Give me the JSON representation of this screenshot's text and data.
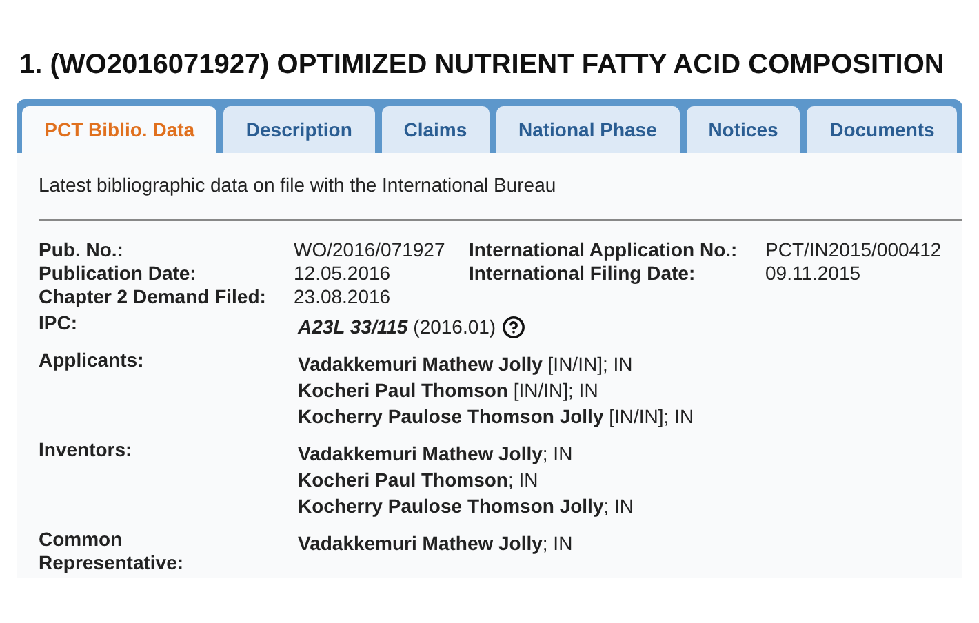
{
  "title": "1. (WO2016071927) OPTIMIZED NUTRIENT FATTY ACID COMPOSITION",
  "tabs": [
    {
      "label": "PCT Biblio. Data",
      "selected": true
    },
    {
      "label": "Description",
      "selected": false
    },
    {
      "label": "Claims",
      "selected": false
    },
    {
      "label": "National Phase",
      "selected": false
    },
    {
      "label": "Notices",
      "selected": false
    },
    {
      "label": "Documents",
      "selected": false
    }
  ],
  "intro": "Latest bibliographic data on file with the International Bureau",
  "summary": [
    {
      "label": "Pub. No.:",
      "value": "WO/2016/071927",
      "label_2": "International Application No.:",
      "value_2": "PCT/IN2015/000412"
    },
    {
      "label": "Publication Date:",
      "value": "12.05.2016",
      "label_2": "International Filing Date:",
      "value_2": "09.11.2015"
    },
    {
      "label": "Chapter 2 Demand Filed:",
      "value": "23.08.2016"
    }
  ],
  "ipc": {
    "label": "IPC:",
    "code": "A23L 33/115",
    "version": "(2016.01)"
  },
  "sections": [
    {
      "label": "Applicants:",
      "entries": [
        "**Vadakkemuri Mathew Jolly** [IN/IN]; IN",
        "**Kocheri Paul Thomson** [IN/IN]; IN",
        "**Kocherry Paulose Thomson Jolly** [IN/IN]; IN"
      ]
    },
    {
      "label": "Inventors:",
      "entries": [
        "**Vadakkemuri Mathew Jolly**; IN",
        "**Kocheri Paul Thomson**; IN",
        "**Kocherry Paulose Thomson Jolly**; IN"
      ]
    },
    {
      "label": "Common Representative:",
      "entries": [
        "**Vadakkemuri Mathew Jolly**; IN"
      ]
    }
  ]
}
